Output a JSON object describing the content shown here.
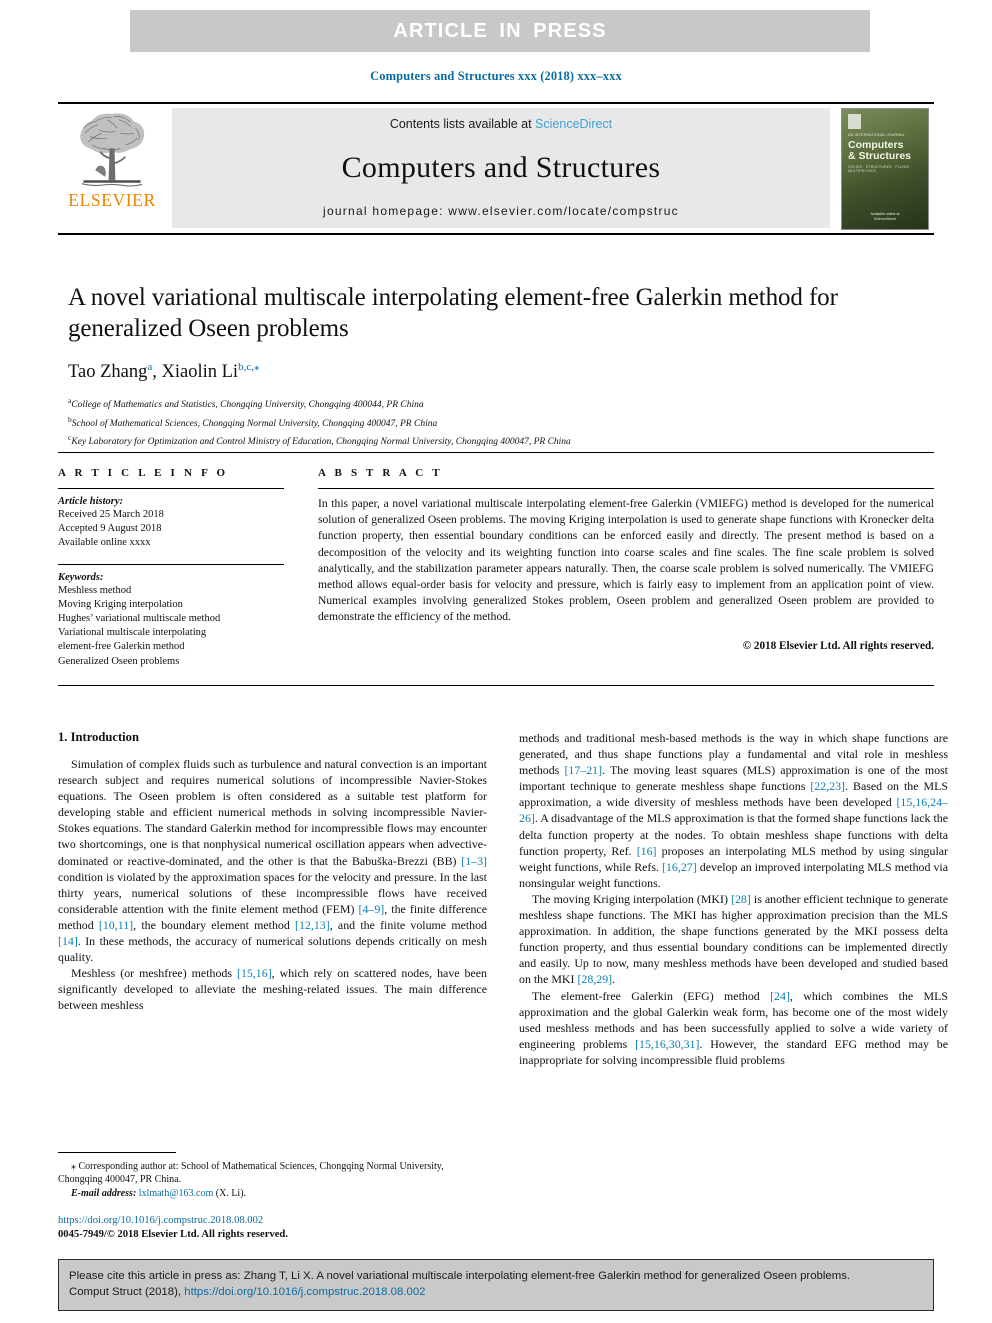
{
  "banner": {
    "label": "ARTICLE  IN  PRESS"
  },
  "running_head": "Computers and Structures xxx (2018) xxx–xxx",
  "masthead": {
    "publisher_wordmark": "ELSEVIER",
    "contents_prefix": "Contents lists available at ",
    "contents_link": "ScienceDirect",
    "journal_title": "Computers and Structures",
    "homepage": "journal homepage: www.elsevier.com/locate/compstruc",
    "cover": {
      "kicker": "AN INTERNATIONAL JOURNAL",
      "title_line1": "Computers",
      "title_line2": "& Structures",
      "subtitle": "SOLIDS · STRUCTURES · FLUIDS · MULTIPHYSICS",
      "footer_line1": "Available online at",
      "footer_line2": "ScienceDirect"
    }
  },
  "article": {
    "title": "A novel variational multiscale interpolating element-free Galerkin method for generalized Oseen problems",
    "authors": [
      {
        "name": "Tao Zhang",
        "marks": "a"
      },
      {
        "name": "Xiaolin Li",
        "marks": "b,c,⁎"
      }
    ],
    "affiliations": [
      {
        "marker": "a",
        "text": "College of Mathematics and Statistics, Chongqing University, Chongqing 400044, PR China"
      },
      {
        "marker": "b",
        "text": "School of Mathematical Sciences, Chongqing Normal University, Chongqing 400047, PR China"
      },
      {
        "marker": "c",
        "text": "Key Laboratory for Optimization and Control Ministry of Education, Chongqing Normal University, Chongqing 400047, PR China"
      }
    ]
  },
  "article_info": {
    "heading": "A R T I C L E   I N F O",
    "history_label": "Article history:",
    "history": [
      "Received 25 March 2018",
      "Accepted 9 August 2018",
      "Available online xxxx"
    ],
    "keywords_label": "Keywords:",
    "keywords": [
      "Meshless method",
      "Moving Kriging interpolation",
      "Hughes’ variational multiscale method",
      "Variational multiscale interpolating",
      "element-free Galerkin method",
      "Generalized Oseen problems"
    ]
  },
  "abstract": {
    "heading": "A B S T R A C T",
    "text": "In this paper, a novel variational multiscale interpolating element-free Galerkin (VMIEFG) method is developed for the numerical solution of generalized Oseen problems. The moving Kriging interpolation is used to generate shape functions with Kronecker delta function property, then essential boundary conditions can be enforced easily and directly. The present method is based on a decomposition of the velocity and its weighting function into coarse scales and fine scales. The fine scale problem is solved analytically, and the stabilization parameter appears naturally. Then, the coarse scale problem is solved numerically. The VMIEFG method allows equal-order basis for velocity and pressure, which is fairly easy to implement from an application point of view. Numerical examples involving generalized Stokes problem, Oseen problem and generalized Oseen problem are provided to demonstrate the efficiency of the method.",
    "copyright": "© 2018 Elsevier Ltd. All rights reserved."
  },
  "body": {
    "section_title": "1. Introduction",
    "left_paragraphs": [
      "Simulation of complex fluids such as turbulence and natural convection is an important research subject and requires numerical solutions of incompressible Navier-Stokes equations. The Oseen problem is often considered as a suitable test platform for developing stable and efficient numerical methods in solving incompressible Navier-Stokes equations. The standard Galerkin method for incompressible flows may encounter two shortcomings, one is that nonphysical numerical oscillation appears when advective-dominated or reactive-dominated, and the other is that the Babuška-Brezzi (BB) [1–3] condition is violated by the approximation spaces for the velocity and pressure. In the last thirty years, numerical solutions of these incompressible flows have received considerable attention with the finite element method (FEM) [4–9], the finite difference method [10,11], the boundary element method [12,13], and the finite volume method [14]. In these methods, the accuracy of numerical solutions depends critically on mesh quality.",
      "Meshless (or meshfree) methods [15,16], which rely on scattered nodes, have been significantly developed to alleviate the meshing-related issues. The main difference between meshless"
    ],
    "right_paragraphs": [
      "methods and traditional mesh-based methods is the way in which shape functions are generated, and thus shape functions play a fundamental and vital role in meshless methods [17–21]. The moving least squares (MLS) approximation is one of the most important technique to generate meshless shape functions [22,23]. Based on the MLS approximation, a wide diversity of meshless methods have been developed [15,16,24–26]. A disadvantage of the MLS approximation is that the formed shape functions lack the delta function property at the nodes. To obtain meshless shape functions with delta function property, Ref. [16] proposes an interpolating MLS method by using singular weight functions, while Refs. [16,27] develop an improved interpolating MLS method via nonsingular weight functions.",
      "The moving Kriging interpolation (MKI) [28] is another efficient technique to generate meshless shape functions. The MKI has higher approximation precision than the MLS approximation. In addition, the shape functions generated by the MKI possess delta function property, and thus essential boundary conditions can be implemented directly and easily. Up to now, many meshless methods have been developed and studied based on the MKI [28,29].",
      "The element-free Galerkin (EFG) method [24], which combines the MLS approximation and the global Galerkin weak form, has become one of the most widely used meshless methods and has been successfully applied to solve a wide variety of engineering problems [15,16,30,31]. However, the standard EFG method may be inappropriate for solving incompressible fluid problems"
    ]
  },
  "footnote": {
    "star": "⁎",
    "corresponding": "Corresponding author at: School of Mathematical Sciences, Chongqing Normal University, Chongqing 400047, PR China.",
    "email_label": "E-mail address:",
    "email": "lxlmath@163.com",
    "email_suffix": "(X. Li).",
    "doi": "https://doi.org/10.1016/j.compstruc.2018.08.002",
    "issn": "0045-7949/© 2018 Elsevier Ltd. All rights reserved."
  },
  "cite_box": {
    "line1": "Please cite this article in press as: Zhang T, Li X. A novel variational multiscale interpolating element-free Galerkin method for generalized Oseen problems.",
    "line2_prefix": "Comput Struct (2018), ",
    "line2_link": "https://doi.org/10.1016/j.compstruc.2018.08.002"
  },
  "colors": {
    "link_blue": "#0e7fb5",
    "header_blue": "#0b6ca0",
    "sciencedirect_blue": "#3fa0d8",
    "elsevier_orange": "#ef8200",
    "banner_gray": "#c7c8ca",
    "cite_gray": "#c9c9c9"
  }
}
